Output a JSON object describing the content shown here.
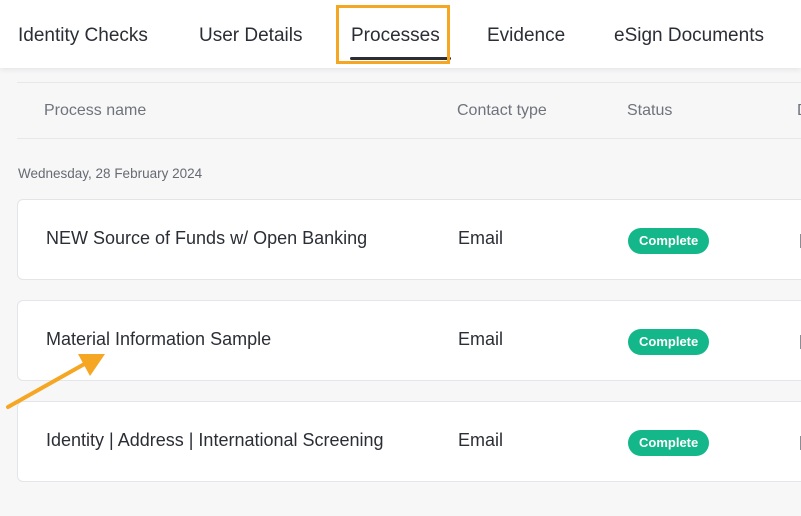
{
  "tabs": [
    {
      "label": "Identity Checks",
      "active": false
    },
    {
      "label": "User Details",
      "active": false
    },
    {
      "label": "Processes",
      "active": true
    },
    {
      "label": "Evidence",
      "active": false
    },
    {
      "label": "eSign Documents",
      "active": false
    }
  ],
  "table": {
    "columns": [
      "Process name",
      "Contact type",
      "Status",
      "D"
    ],
    "date_group": "Wednesday, 28 February 2024",
    "rows": [
      {
        "process_name": "NEW Source of Funds w/ Open Banking",
        "contact_type": "Email",
        "status": "Complete"
      },
      {
        "process_name": "Material Information Sample",
        "contact_type": "Email",
        "status": "Complete"
      },
      {
        "process_name": "Identity | Address | International Screening",
        "contact_type": "Email",
        "status": "Complete"
      }
    ]
  },
  "colors": {
    "highlight": "#f5a623",
    "status_complete": "#14b789",
    "active_underline": "#2b2e35"
  },
  "annotation": {
    "arrow_icon": "arrow-up-right-icon"
  }
}
